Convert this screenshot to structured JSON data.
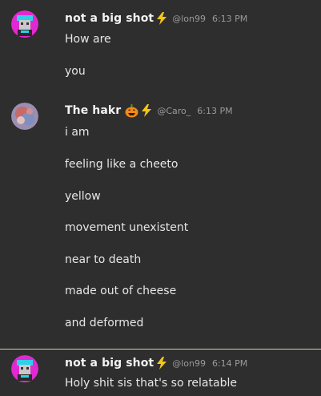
{
  "messages": [
    {
      "username": "not a big shot",
      "handle": "@lon99",
      "time": "6:13 PM",
      "lines": [
        "How are",
        "you"
      ]
    },
    {
      "username": "The hakr",
      "handle": "@Caro_",
      "time": "6:13 PM",
      "lines": [
        "i am",
        "feeling like a cheeto",
        "yellow",
        "movement unexistent",
        "near to death",
        "made out of cheese",
        "and deformed"
      ]
    },
    {
      "username": "not a big shot",
      "handle": "@lon99",
      "time": "6:14 PM",
      "lines": [
        "Holy shit sis that's so relatable"
      ]
    }
  ],
  "colors": {
    "background": "#2e2e2e",
    "bolt": "#f5c518",
    "unread_divider": "#d8d2a0"
  },
  "icons": {
    "badge": "lightning-bolt",
    "emoji": "jack-o-lantern"
  }
}
